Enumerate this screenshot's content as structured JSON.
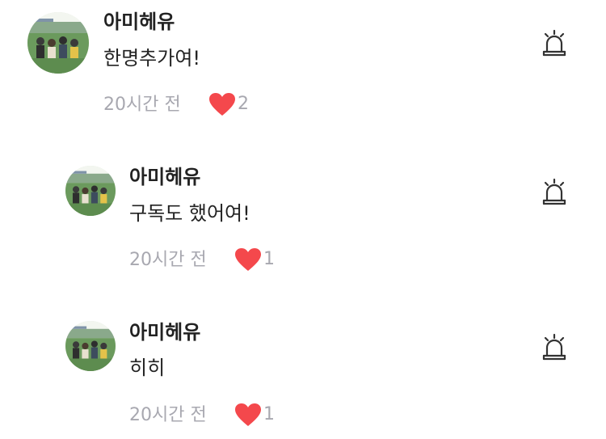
{
  "comments": [
    {
      "author": "아미헤유",
      "text": "한명추가여!",
      "time": "20시간 전",
      "likes": "2",
      "avatar_icon": "group-photo-avatar",
      "report_icon": "siren-icon"
    },
    {
      "author": "아미헤유",
      "text": "구독도 했어여!",
      "time": "20시간 전",
      "likes": "1",
      "avatar_icon": "group-photo-avatar",
      "report_icon": "siren-icon"
    },
    {
      "author": "아미헤유",
      "text": "히히",
      "time": "20시간 전",
      "likes": "1",
      "avatar_icon": "group-photo-avatar",
      "report_icon": "siren-icon"
    }
  ],
  "colors": {
    "heart": "#f4484c",
    "muted_text": "#a8a8b0",
    "primary_text": "#222222"
  }
}
